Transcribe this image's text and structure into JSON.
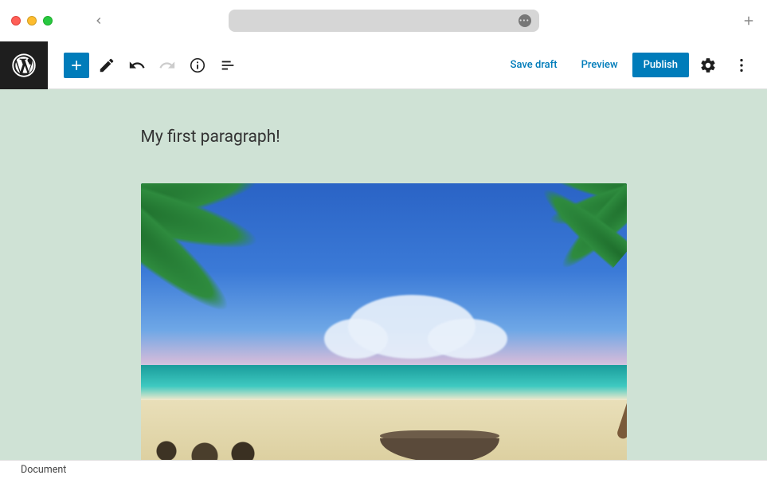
{
  "toolbar": {
    "save_draft": "Save draft",
    "preview": "Preview",
    "publish": "Publish"
  },
  "content": {
    "paragraph": "My first paragraph!"
  },
  "footer": {
    "breadcrumb": "Document"
  }
}
